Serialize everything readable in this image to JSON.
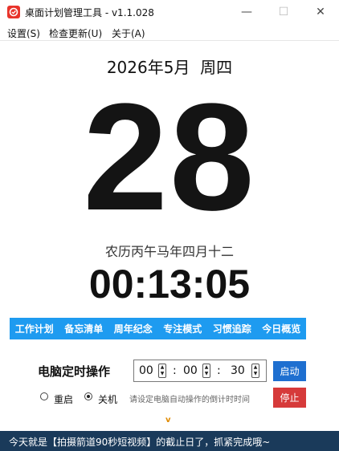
{
  "window": {
    "title": "桌面计划管理工具 - v1.1.028",
    "minimize": "—",
    "maximize": "☐",
    "close": "✕",
    "icon": "app-logo-icon"
  },
  "menu": {
    "settings": "设置(S)",
    "check_update": "检查更新(U)",
    "about": "关于(A)"
  },
  "calendar": {
    "year_month": "2026年5月",
    "weekday": "周四",
    "day": "28",
    "lunar": "农历丙午马年四月十二",
    "time": "00:13:05"
  },
  "tabs": [
    "工作计划",
    "备忘清单",
    "周年纪念",
    "专注模式",
    "习惯追踪",
    "今日概览"
  ],
  "timer": {
    "label": "电脑定时操作",
    "hours": "00",
    "minutes": "00",
    "seconds": "30",
    "colon": ":",
    "start_label": "启动",
    "stop_label": "停止",
    "options": [
      "重启",
      "关机"
    ],
    "selected_option": "关机",
    "hint": "请设定电脑自动操作的倒计时时间"
  },
  "expand_toggle": "v",
  "status": {
    "message": "今天就是【拍摄箭道90秒短视频】的截止日了，抓紧完成哦~"
  },
  "colors": {
    "tab_bar": "#1e9bf0",
    "start_button": "#1e6fd0",
    "stop_button": "#d63a3a",
    "status_bar": "#1a3a5a",
    "app_icon": "#e8342b"
  }
}
